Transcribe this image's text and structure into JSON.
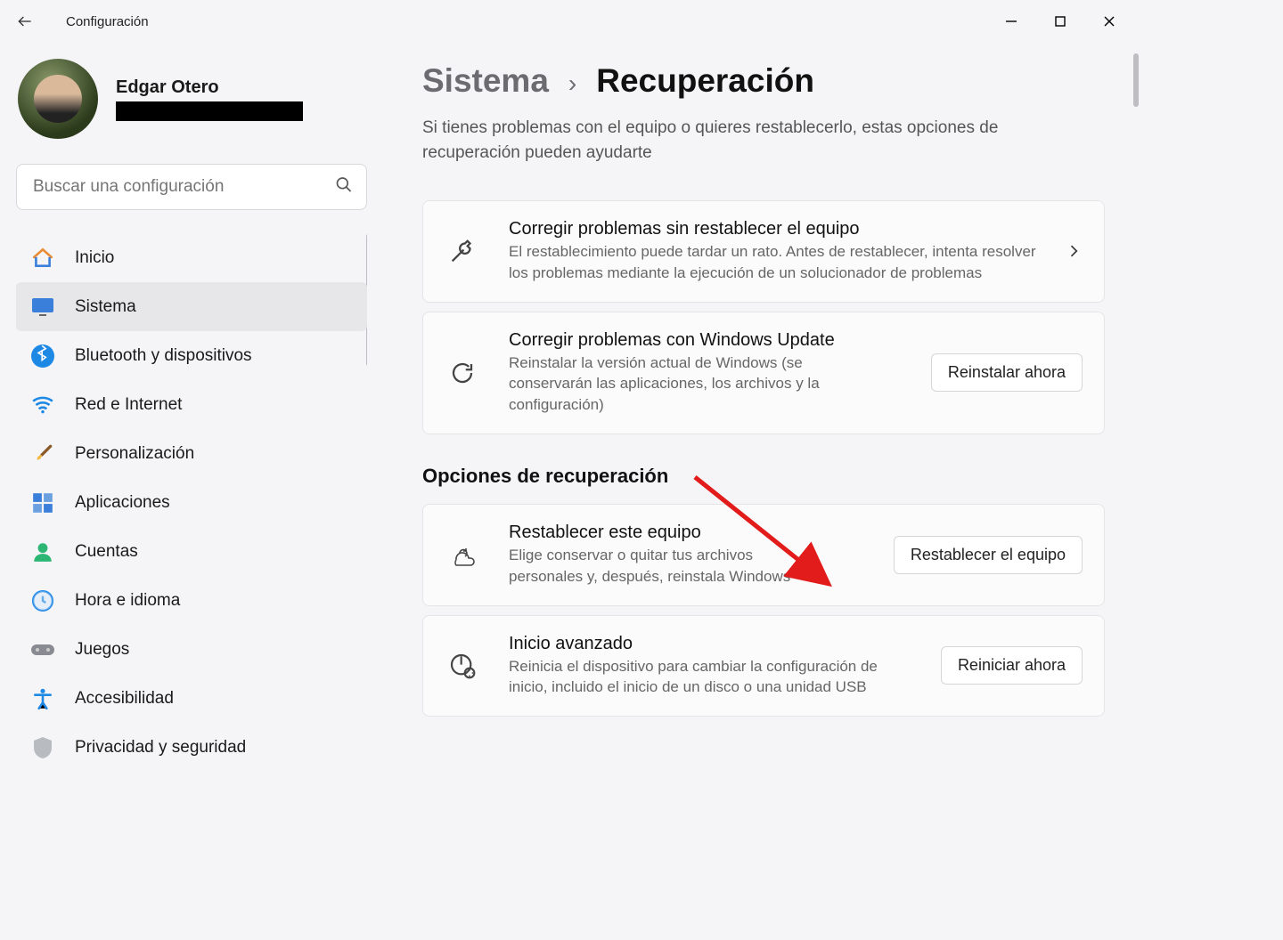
{
  "window": {
    "title": "Configuración"
  },
  "user": {
    "name": "Edgar Otero"
  },
  "search": {
    "placeholder": "Buscar una configuración"
  },
  "nav": {
    "items": [
      {
        "id": "inicio",
        "label": "Inicio"
      },
      {
        "id": "sistema",
        "label": "Sistema"
      },
      {
        "id": "bluetooth",
        "label": "Bluetooth y dispositivos"
      },
      {
        "id": "red",
        "label": "Red e Internet"
      },
      {
        "id": "personalizacion",
        "label": "Personalización"
      },
      {
        "id": "aplicaciones",
        "label": "Aplicaciones"
      },
      {
        "id": "cuentas",
        "label": "Cuentas"
      },
      {
        "id": "hora",
        "label": "Hora e idioma"
      },
      {
        "id": "juegos",
        "label": "Juegos"
      },
      {
        "id": "accesibilidad",
        "label": "Accesibilidad"
      },
      {
        "id": "privacidad",
        "label": "Privacidad y seguridad"
      }
    ]
  },
  "breadcrumb": {
    "parent": "Sistema",
    "sep": "›",
    "current": "Recuperación"
  },
  "page": {
    "description": "Si tienes problemas con el equipo o quieres restablecerlo, estas opciones de recuperación pueden ayudarte",
    "section_recovery": "Opciones de recuperación"
  },
  "cards": {
    "fix": {
      "title": "Corregir problemas sin restablecer el equipo",
      "desc": "El restablecimiento puede tardar un rato. Antes de restablecer, intenta resolver los problemas mediante la ejecución de un solucionador de problemas"
    },
    "wu": {
      "title": "Corregir problemas con Windows Update",
      "desc": "Reinstalar la versión actual de Windows (se conservarán las aplicaciones, los archivos y la configuración)",
      "button": "Reinstalar ahora"
    },
    "reset": {
      "title": "Restablecer este equipo",
      "desc": "Elige conservar o quitar tus archivos personales y, después, reinstala Windows",
      "button": "Restablecer el equipo"
    },
    "advanced": {
      "title": "Inicio avanzado",
      "desc": "Reinicia el dispositivo para cambiar la configuración de inicio, incluido el inicio de un disco o una unidad USB",
      "button": "Reiniciar ahora"
    }
  }
}
